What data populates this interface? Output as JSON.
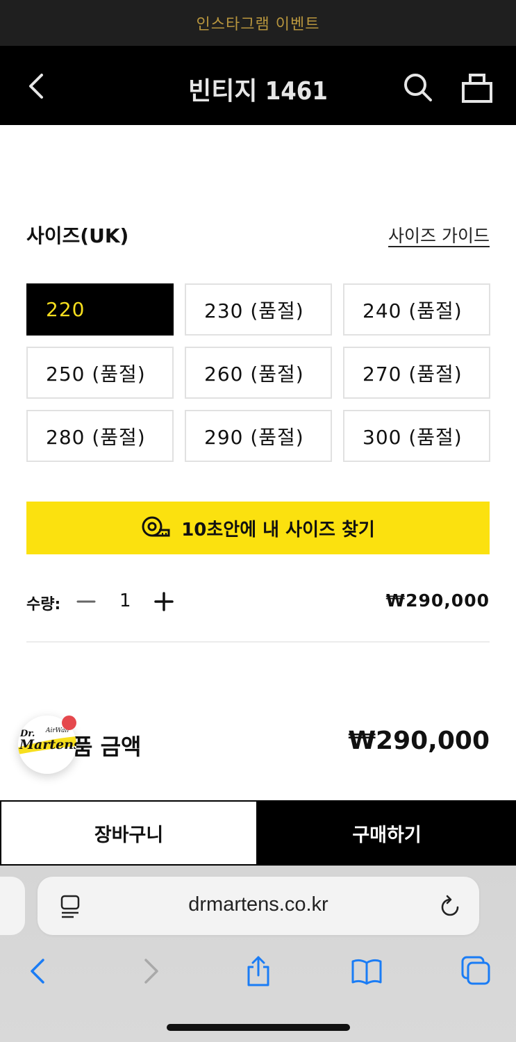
{
  "promo": {
    "text": "인스타그램 이벤트"
  },
  "header": {
    "title": "빈티지 1461"
  },
  "sizes": {
    "title": "사이즈(UK)",
    "guide_label": "사이즈 가이드",
    "options": [
      {
        "label": "220",
        "selected": true
      },
      {
        "label": "230 (품절)",
        "selected": false
      },
      {
        "label": "240 (품절)",
        "selected": false
      },
      {
        "label": "250 (품절)",
        "selected": false
      },
      {
        "label": "260 (품절)",
        "selected": false
      },
      {
        "label": "270 (품절)",
        "selected": false
      },
      {
        "label": "280 (품절)",
        "selected": false
      },
      {
        "label": "290 (품절)",
        "selected": false
      },
      {
        "label": "300 (품절)",
        "selected": false
      }
    ]
  },
  "finder": {
    "label": "10초안에 내 사이즈 찾기"
  },
  "quantity": {
    "label": "수량:",
    "value": "1",
    "price": "₩290,000"
  },
  "total": {
    "label": "품 금액",
    "price": "₩290,000"
  },
  "actions": {
    "cart_label": "장바구니",
    "buy_label": "구매하기"
  },
  "browser": {
    "url": "drmartens.co.kr"
  },
  "colors": {
    "accent_yellow": "#fbe10f",
    "selected_text": "#f7df1e",
    "promo_text": "#b8963e",
    "ios_blue": "#1a7cf5",
    "badge_red": "#e5484d"
  },
  "brand": {
    "logo_text_top": "Dr.",
    "logo_text_main": "Martens",
    "logo_text_sub": "AirWair"
  }
}
